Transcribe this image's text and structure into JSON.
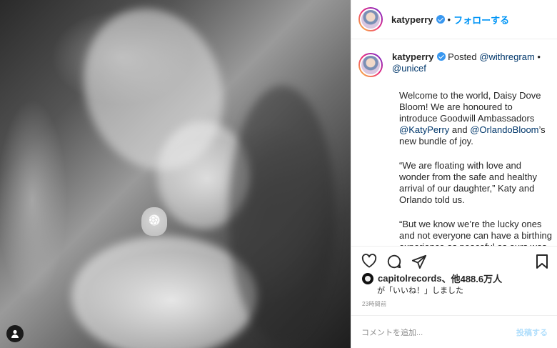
{
  "post": {
    "username": "katyperry",
    "follow_label": "フォローする",
    "separator": "•"
  },
  "caption": {
    "username": "katyperry",
    "posted_prefix": "Posted",
    "posted_with": "@withregram",
    "separator": "•",
    "posted_via": "@unicef",
    "p1_a": "Welcome to the world, Daisy Dove Bloom! We are honoured to introduce Goodwill Ambassadors ",
    "p1_mention1": "@KatyPerry",
    "p1_b": " and ",
    "p1_mention2": "@OrlandoBloom",
    "p1_c": "’s new bundle of joy.",
    "p2": "“We are floating with love and wonder from the safe and healthy arrival of our daughter,” Katy and Orlando told us.",
    "p3": "“But we know we’re the lucky ones and not everyone can have a birthing experience as peaceful as ours was."
  },
  "likes": {
    "liker": "capitolrecords",
    "count_text": "、他488.6万人",
    "line2": "が「いいね！」しました"
  },
  "timestamp": "23時間前",
  "comment": {
    "placeholder": "コメントを追加...",
    "post_label": "投稿する"
  },
  "colors": {
    "accent": "#0095f6",
    "link": "#00376b",
    "verified": "#3897f0"
  },
  "icons": [
    "heart-icon",
    "comment-icon",
    "share-icon",
    "bookmark-icon",
    "verified-badge-icon",
    "user-tag-icon"
  ]
}
